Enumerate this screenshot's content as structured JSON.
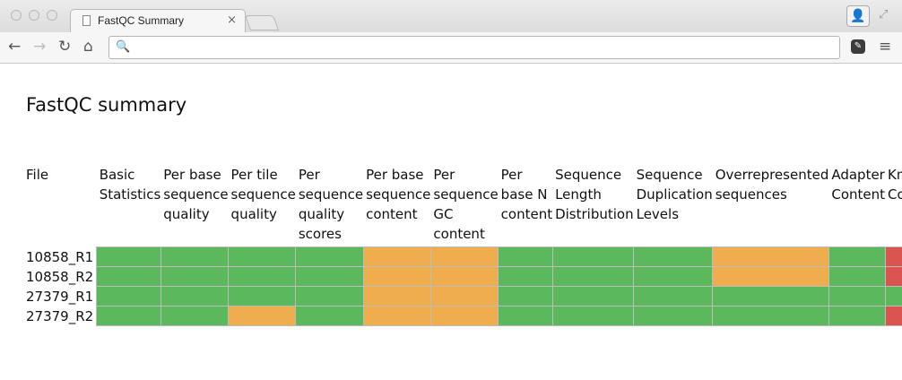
{
  "browser": {
    "tab_title": "FastQC Summary",
    "tab_close": "×",
    "address_value": "",
    "address_placeholder": ""
  },
  "page": {
    "title": "FastQC summary"
  },
  "table": {
    "columns": [
      "File",
      "Basic Statistics",
      "Per base sequence quality",
      "Per tile sequence quality",
      "Per sequence quality scores",
      "Per base sequence content",
      "Per sequence GC content",
      "Per base N content",
      "Sequence Length Distribution",
      "Sequence Duplication Levels",
      "Overrepresented sequences",
      "Adapter Content",
      "Kmer Content"
    ],
    "rows": [
      {
        "file": "10858_R1",
        "status": [
          "pass",
          "pass",
          "pass",
          "pass",
          "warn",
          "warn",
          "pass",
          "pass",
          "pass",
          "warn",
          "pass",
          "fail"
        ]
      },
      {
        "file": "10858_R2",
        "status": [
          "pass",
          "pass",
          "pass",
          "pass",
          "warn",
          "warn",
          "pass",
          "pass",
          "pass",
          "warn",
          "pass",
          "fail"
        ]
      },
      {
        "file": "27379_R1",
        "status": [
          "pass",
          "pass",
          "pass",
          "pass",
          "warn",
          "warn",
          "pass",
          "pass",
          "pass",
          "pass",
          "pass",
          "pass"
        ]
      },
      {
        "file": "27379_R2",
        "status": [
          "pass",
          "pass",
          "warn",
          "pass",
          "warn",
          "warn",
          "pass",
          "pass",
          "pass",
          "pass",
          "pass",
          "fail"
        ]
      }
    ]
  },
  "colors": {
    "pass": "#5cb85c",
    "warn": "#f0ad4e",
    "fail": "#d9534f"
  }
}
